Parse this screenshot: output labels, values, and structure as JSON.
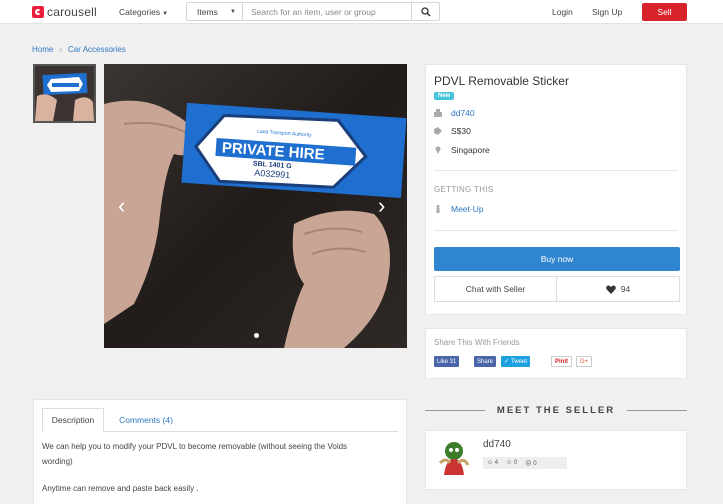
{
  "nav": {
    "logo_text": "carousell",
    "categories_label": "Categories",
    "search_scope": "Items",
    "search_placeholder": "Search for an item, user or group",
    "login_label": "Login",
    "signup_label": "Sign Up",
    "sell_label": "Sell"
  },
  "breadcrumb": {
    "items": [
      "Home",
      "Car Accessories"
    ]
  },
  "photo": {
    "sticker_org": "Land Transport Authority",
    "sticker_main": "PRIVATE HIRE",
    "sticker_sub": "SBL 1401 G",
    "sticker_code": "A032991"
  },
  "listing": {
    "title": "PDVL Removable Sticker",
    "condition": "New",
    "seller": "dd740",
    "price": "S$30",
    "location": "Singapore",
    "getting_label": "GETTING THIS",
    "meetup_label": "Meet-Up",
    "buy_label": "Buy now",
    "chat_label": "Chat with Seller",
    "likes": "94"
  },
  "share": {
    "title": "Share This With Friends",
    "fb_label": "Like 31",
    "fb_share": "Share",
    "tweet_label": "Tweet",
    "pin_label": "Pinit",
    "gplus_label": "G+"
  },
  "description": {
    "tab_description": "Description",
    "tab_comments": "Comments (4)",
    "line1": "We can help you to modify your PDVL to become removable (without seeing the Voids",
    "line2": "wording)",
    "line3": "Anytime can remove and paste back easily ."
  },
  "seller": {
    "heading": "MEET THE SELLER",
    "name": "dd740",
    "stat1": "4",
    "stat2": "0",
    "stat3": "0"
  },
  "colors": {
    "brand": "#d8232a",
    "link": "#2f78c3",
    "buy_button": "#2f85cf",
    "badge": "#45c3dd",
    "sticker_blue": "#1e6fd0"
  }
}
